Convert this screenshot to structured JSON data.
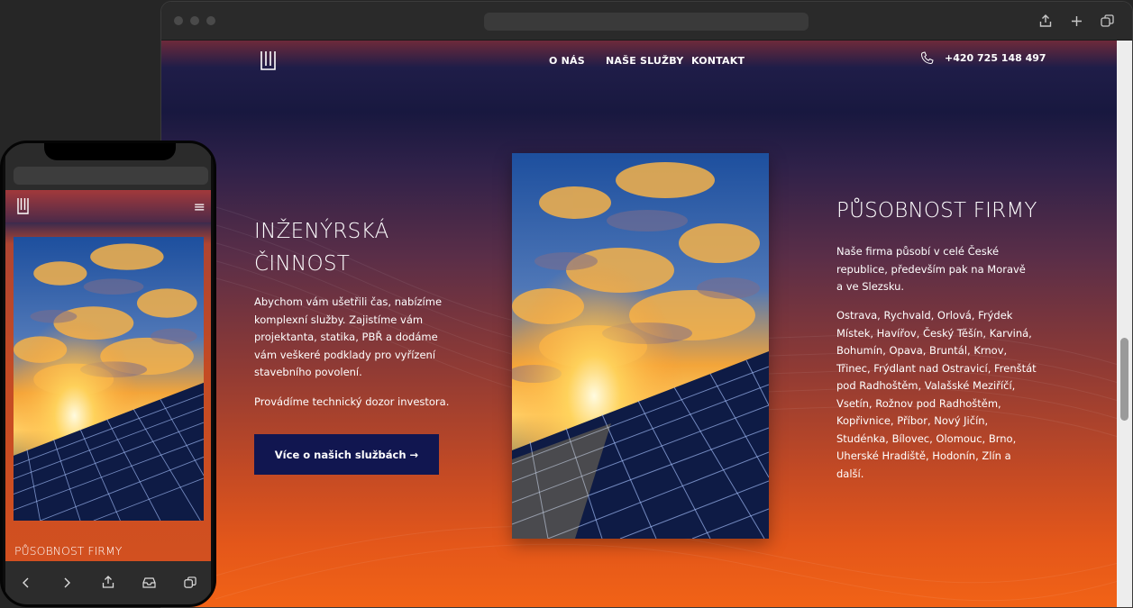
{
  "desktop": {
    "nav": {
      "about": "O NÁS",
      "services": "NAŠE SLUŽBY",
      "contact": "KONTAKT"
    },
    "phone": "+420 725 148 497",
    "left": {
      "title_line1": "INŽENÝRSKÁ",
      "title_line2": "ČINNOST",
      "text1": "Abychom vám ušetřili čas, nabízíme komplexní služby. Zajistíme vám projektanta, statika, PBŘ a dodáme vám veškeré podklady pro vyřízení stavebního povolení.",
      "text2": "Provádíme technický dozor investora.",
      "cta": "Více o našich službách →"
    },
    "right": {
      "title": "PŮSOBNOST FIRMY",
      "text1": "Naše firma působí v celé České republice, především pak na Moravě a ve Slezsku.",
      "text2": "Ostrava, Rychvald, Orlová, Frýdek Místek, Havířov, Český Těšín, Karviná, Bohumín, Opava, Bruntál, Krnov, Třinec, Frýdlant nad Ostravicí, Frenštát pod Radhoštěm, Valašské Meziříčí, Vsetín, Rožnov pod Radhoštěm, Kopřivnice, Příbor, Nový Jičín, Studénka, Bílovec, Olomouc, Brno, Uherské Hradiště, Hodonín, Zlín a další."
    }
  },
  "mobile": {
    "title": "PŮSOBNOST FIRMY",
    "menu_icon": "≡"
  },
  "icons": {
    "upload": "upload-icon",
    "new_tab": "plus-icon",
    "tabs": "tabs-icon",
    "phone": "phone-icon",
    "back": "chevron-left-icon",
    "forward": "chevron-right-icon",
    "share": "share-icon",
    "inbox": "inbox-icon",
    "copy": "tabs-icon"
  },
  "colors": {
    "navy": "#111650",
    "orange": "#f26316",
    "dark_bg": "#262626"
  }
}
